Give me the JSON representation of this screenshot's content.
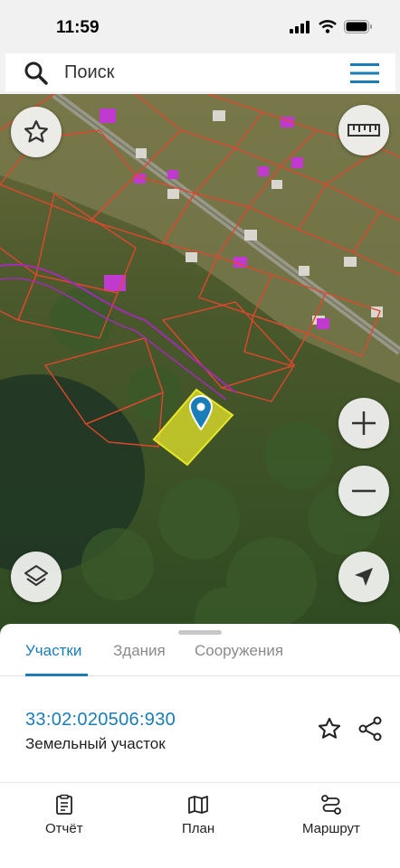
{
  "status_bar": {
    "time": "11:59"
  },
  "search": {
    "placeholder": "Поиск"
  },
  "map": {
    "controls": [
      "favorites",
      "ruler",
      "zoom-in",
      "zoom-out",
      "layers",
      "locate"
    ]
  },
  "sheet": {
    "tabs": [
      {
        "label": "Участки",
        "active": true
      },
      {
        "label": "Здания",
        "active": false
      },
      {
        "label": "Сооружения",
        "active": false
      }
    ],
    "result": {
      "cadastral_number": "33:02:020506:930",
      "type": "Земельный участок"
    }
  },
  "nav": {
    "items": [
      {
        "label": "Отчёт",
        "icon": "report-icon"
      },
      {
        "label": "План",
        "icon": "map-icon"
      },
      {
        "label": "Маршрут",
        "icon": "route-icon"
      }
    ]
  },
  "colors": {
    "accent": "#1a7db8",
    "parcel_border": "#e0472e",
    "selected_parcel": "#e6e62a"
  }
}
